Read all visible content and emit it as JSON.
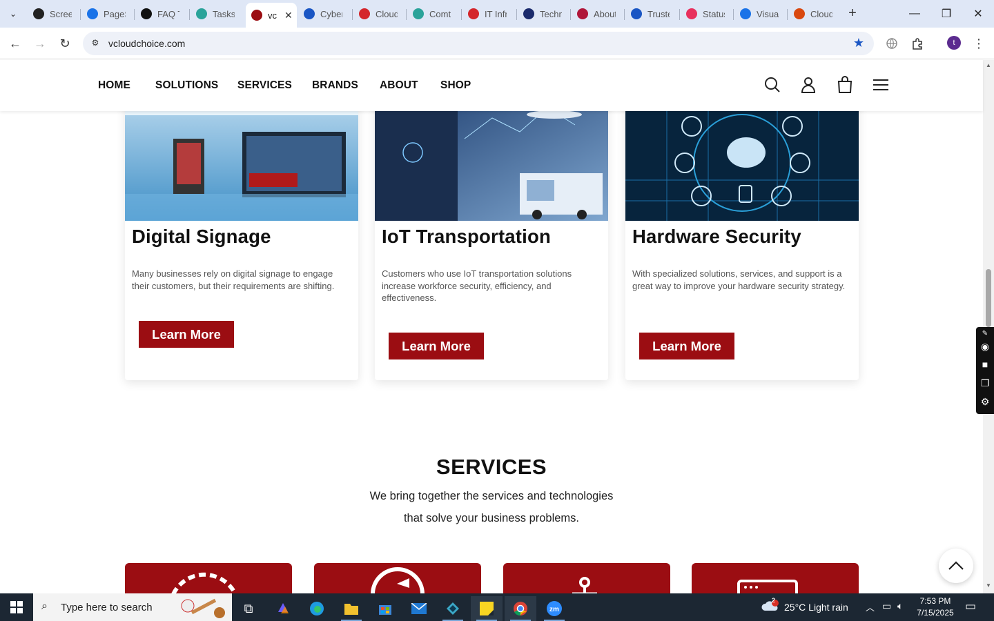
{
  "browser": {
    "tabs": [
      {
        "title": "Screen",
        "icon": "screencast-icon",
        "color": "#222"
      },
      {
        "title": "PageS",
        "icon": "pagespeed-icon",
        "color": "#1a73e8"
      },
      {
        "title": "FAQ T",
        "icon": "faq-icon",
        "color": "#111"
      },
      {
        "title": "Tasks",
        "icon": "tasks-icon",
        "color": "#2aa39a"
      },
      {
        "title": "vc",
        "icon": "vcloud-icon",
        "color": "#9b0d12",
        "active": true
      },
      {
        "title": "Cyber",
        "icon": "cyber-icon",
        "color": "#1a56c4"
      },
      {
        "title": "Cloud",
        "icon": "cloud-shield-icon",
        "color": "#d4262b"
      },
      {
        "title": "Comt",
        "icon": "comptia-icon",
        "color": "#2aa39a"
      },
      {
        "title": "IT Infr",
        "icon": "it-shield-icon",
        "color": "#d4262b"
      },
      {
        "title": "Techn",
        "icon": "tech-x-icon",
        "color": "#1a2a6c"
      },
      {
        "title": "About",
        "icon": "about-icon",
        "color": "#b0163a"
      },
      {
        "title": "Truste",
        "icon": "scales-icon",
        "color": "#1a56c4"
      },
      {
        "title": "Status",
        "icon": "status-icon",
        "color": "#e8305d"
      },
      {
        "title": "Visual",
        "icon": "visual-icon",
        "color": "#1a73e8"
      },
      {
        "title": "Cloud",
        "icon": "cloud-red-icon",
        "color": "#d9480f"
      }
    ],
    "url": "vcloudchoice.com",
    "profile_initial": "t"
  },
  "site": {
    "nav": [
      "HOME",
      "SOLUTIONS",
      "SERVICES",
      "BRANDS",
      "ABOUT",
      "SHOP"
    ],
    "brand_color": "#9b0d12",
    "cards": [
      {
        "title": "Digital Signage",
        "text": "Many businesses rely on digital signage to engage their customers, but their requirements are shifting.",
        "button": "Learn More"
      },
      {
        "title": "IoT Transportation",
        "text": "Customers who use IoT transportation solutions increase workforce security, efficiency, and effectiveness.",
        "button": "Learn More"
      },
      {
        "title": "Hardware Security",
        "text": "With specialized solutions, services, and support is a great way to improve your hardware security strategy.",
        "button": "Learn More"
      }
    ],
    "services": {
      "title": "SERVICES",
      "subtitle_line1": "We bring together the services and technologies",
      "subtitle_line2": "that solve your business problems."
    }
  },
  "taskbar": {
    "search_placeholder": "Type here to search",
    "weather": "25°C  Light rain",
    "weather_badge": "2",
    "time": "7:53 PM",
    "date": "7/15/2025"
  }
}
